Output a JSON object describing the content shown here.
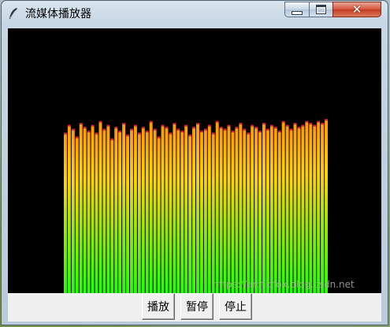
{
  "window": {
    "title": "流媒体播放器",
    "icon": "feather-icon",
    "controls": {
      "minimize": "minimize-icon",
      "maximize": "maximize-icon",
      "close": "close-icon"
    }
  },
  "visualizer": {
    "background": "#000000",
    "gradient_colors": [
      "#ff9a00",
      "#ffd400",
      "#22ff00"
    ],
    "peak_color": "#e0203a",
    "bar_count": 68,
    "levels": [
      0.82,
      0.86,
      0.84,
      0.8,
      0.87,
      0.85,
      0.83,
      0.86,
      0.82,
      0.88,
      0.84,
      0.86,
      0.79,
      0.85,
      0.83,
      0.87,
      0.81,
      0.84,
      0.86,
      0.82,
      0.85,
      0.83,
      0.88,
      0.84,
      0.8,
      0.86,
      0.85,
      0.82,
      0.87,
      0.84,
      0.83,
      0.86,
      0.81,
      0.85,
      0.87,
      0.83,
      0.84,
      0.86,
      0.82,
      0.88,
      0.85,
      0.84,
      0.86,
      0.83,
      0.85,
      0.87,
      0.84,
      0.82,
      0.86,
      0.85,
      0.83,
      0.87,
      0.84,
      0.86,
      0.85,
      0.83,
      0.88,
      0.86,
      0.84,
      0.87,
      0.85,
      0.86,
      0.88,
      0.87,
      0.86,
      0.88,
      0.87,
      0.89
    ]
  },
  "buttons": {
    "play": "播放",
    "pause": "暂停",
    "stop": "停止"
  },
  "watermark": "https://arcticfox.blog.csdn.net"
}
